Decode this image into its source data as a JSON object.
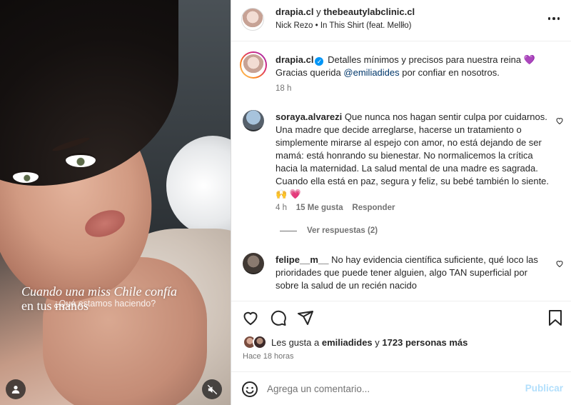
{
  "post": {
    "collaborators_prefix": "drapia.cl",
    "collaborators_join": "y",
    "collaborators_second": "thebeautylabclinic.cl",
    "audio": "Nick Rezo • In This Shirt (feat. Mellło)"
  },
  "media": {
    "overlay_line1": "Cuando una miss Chile confía",
    "overlay_line2": "en tus manos",
    "overlay_sub": "¿Qué estamos haciendo?"
  },
  "caption": {
    "username": "drapia.cl",
    "text_part1": "Detalles mínimos y precisos para nuestra reina 💜",
    "text_part2": "Gracias querida",
    "mention": "@emiliadides",
    "text_part3": "por confiar en nosotros.",
    "time": "18 h"
  },
  "comments": [
    {
      "username": "soraya.alvarezi",
      "text": "Que nunca nos hagan sentir culpa por cuidarnos. Una madre que decide arreglarse, hacerse un tratamiento o simplemente mirarse al espejo con amor, no está dejando de ser mamá: está honrando su bienestar. No normalicemos la crítica hacia la maternidad. La salud mental de una madre es sagrada. Cuando ella está en paz, segura y feliz, su bebé también lo siente.🙌 💗",
      "time": "4 h",
      "likes": "15 Me gusta",
      "reply": "Responder",
      "view_replies": "Ver respuestas (2)"
    },
    {
      "username": "felipe__m__",
      "text": "No hay evidencia científica suficiente, qué loco las prioridades que puede tener alguien, algo TAN superficial por sobre la salud de un recién nacido"
    }
  ],
  "likes": {
    "prefix": "Les gusta a",
    "user": "emiliadides",
    "join": "y",
    "count": "1723 personas más"
  },
  "posted_ago": "Hace 18 horas",
  "composer": {
    "placeholder": "Agrega un comentario...",
    "post_label": "Publicar"
  },
  "colors": {
    "link": "#00376b",
    "verified": "#0095f6",
    "post_disabled": "#b2dffc",
    "secondary_text": "#737373"
  },
  "icons": [
    "more-icon",
    "verified-badge-icon",
    "heart-icon",
    "comment-icon",
    "share-icon",
    "save-icon",
    "emoji-icon",
    "user-tag-icon",
    "muted-audio-icon"
  ]
}
